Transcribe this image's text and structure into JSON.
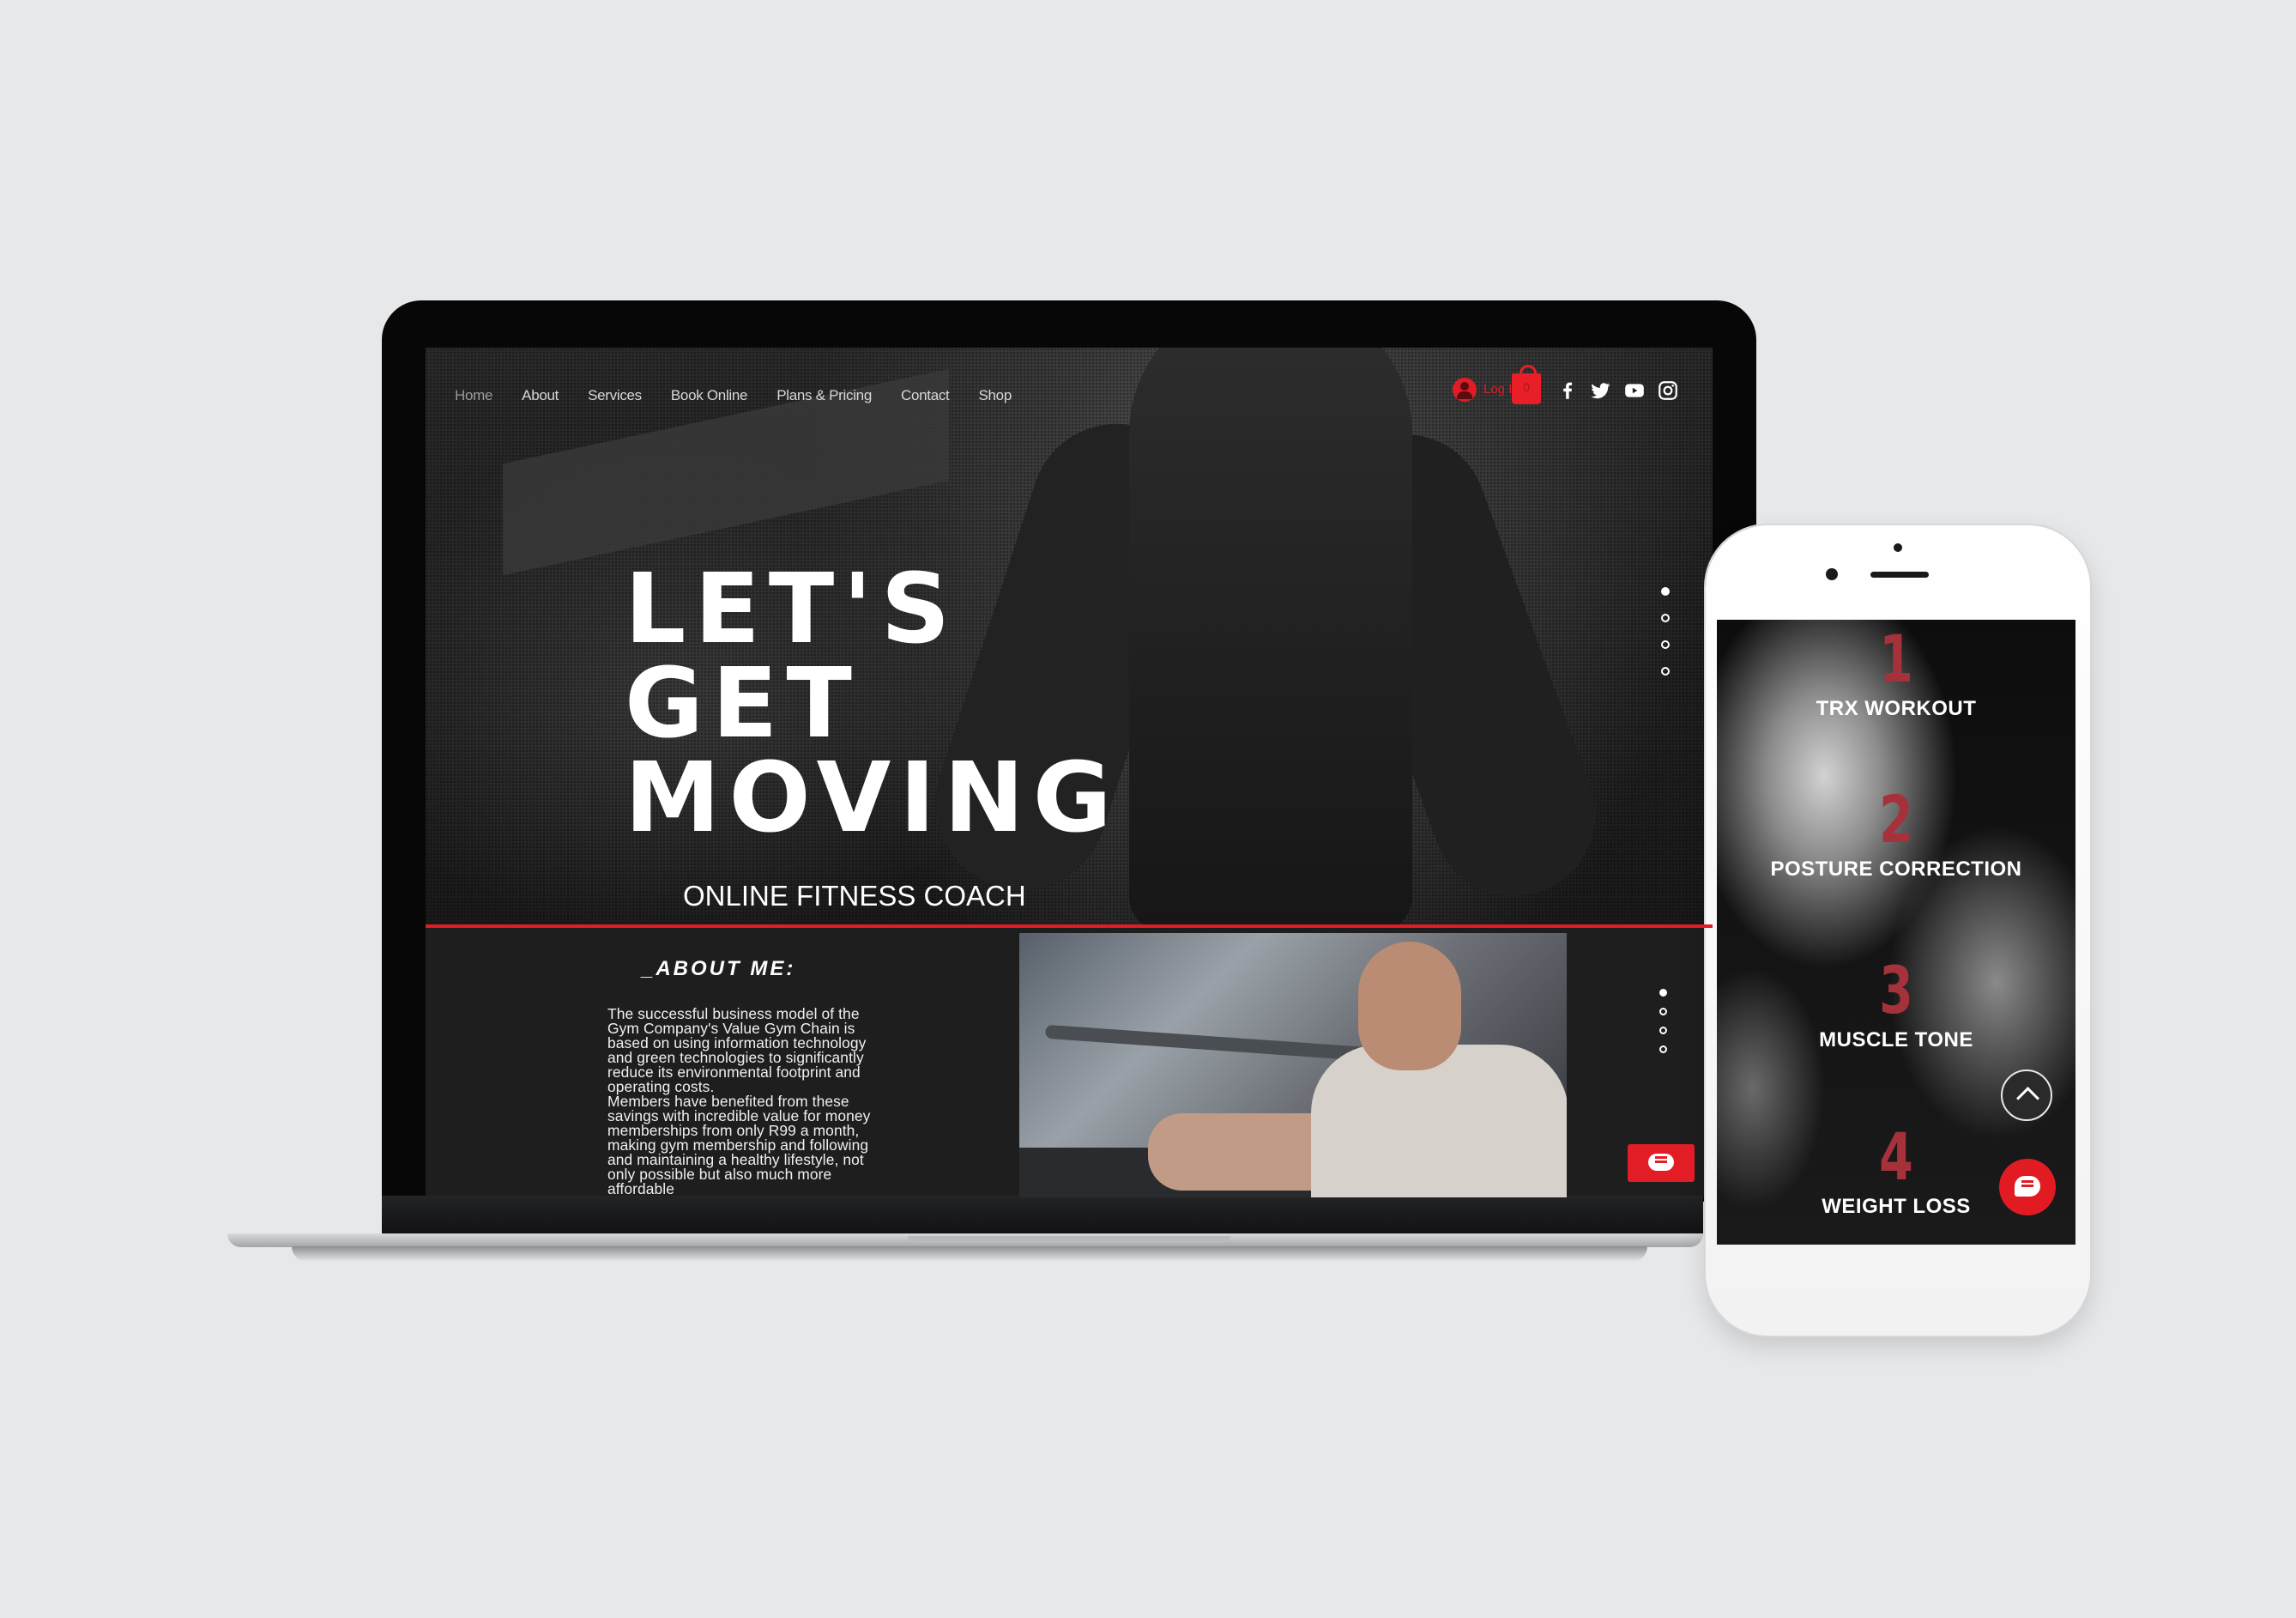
{
  "laptop": {
    "nav": {
      "items": [
        "Home",
        "About",
        "Services",
        "Book Online",
        "Plans & Pricing",
        "Contact",
        "Shop"
      ],
      "login_label": "Log In",
      "cart_count": "0"
    },
    "social_icons": [
      "facebook-icon",
      "twitter-icon",
      "youtube-icon",
      "instagram-icon"
    ],
    "hero": {
      "title_lines": [
        "LET'S",
        "GET",
        "MOVING"
      ],
      "subtitle": "ONLINE FITNESS COACH",
      "slide_count": 4,
      "active_slide": 1
    },
    "about": {
      "title": "_ABOUT ME:",
      "body": "The successful business model of the\nGym Company's Value Gym Chain is\nbased on using information technology\nand green technologies to significantly\nreduce its environmental footprint and\noperating costs.\nMembers have benefited from these\nsavings with incredible value for money\nmemberships from only R99 a month,\nmaking gym membership and following\nand maintaining a healthy lifestyle, not\nonly possible but also much more\naffordable"
    }
  },
  "phone": {
    "services": [
      {
        "number": "1",
        "label": "TRX WORKOUT"
      },
      {
        "number": "2",
        "label": "POSTURE CORRECTION"
      },
      {
        "number": "3",
        "label": "MUSCLE TONE"
      },
      {
        "number": "4",
        "label": "WEIGHT LOSS"
      }
    ]
  },
  "colors": {
    "accent": "#e01d24",
    "number_red": "#a5323a",
    "background": "#e7e8ea"
  }
}
